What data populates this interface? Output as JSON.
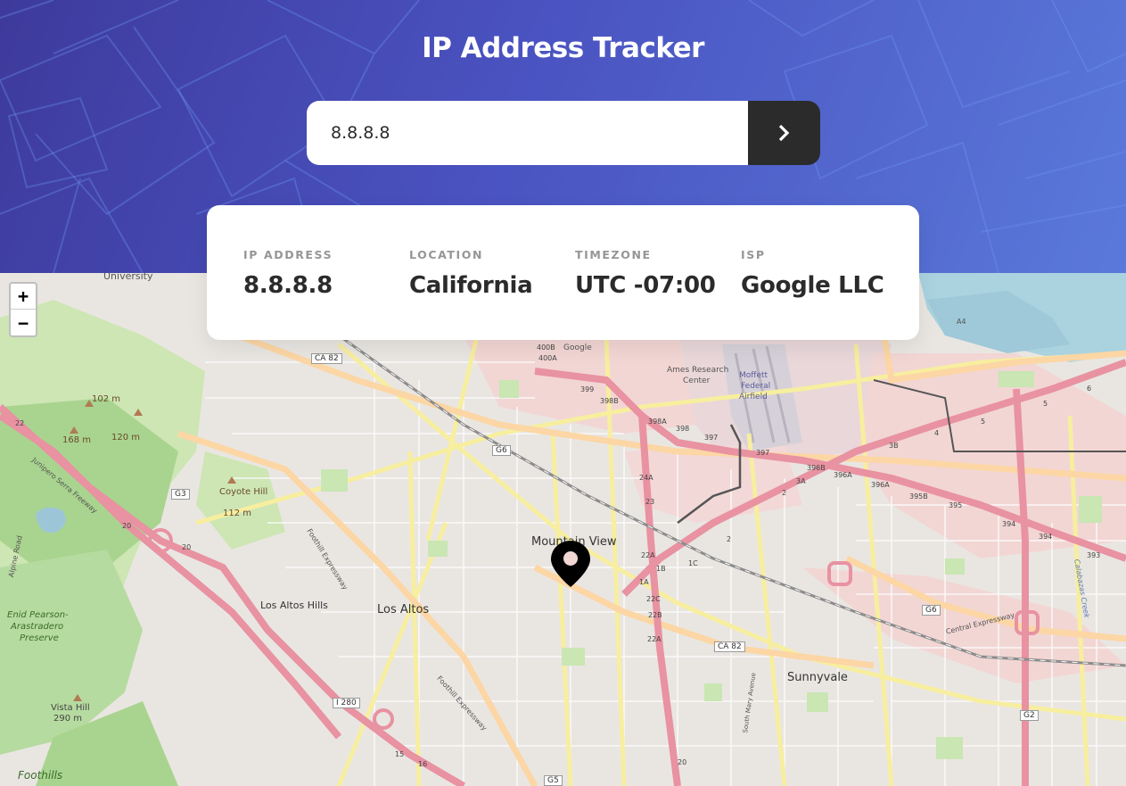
{
  "header": {
    "title": "IP Address Tracker"
  },
  "search": {
    "value": "8.8.8.8",
    "button_icon": "chevron-right-icon"
  },
  "info": {
    "ip": {
      "label": "IP ADDRESS",
      "value": "8.8.8.8"
    },
    "location": {
      "label": "LOCATION",
      "value": "California"
    },
    "timezone": {
      "label": "TIMEZONE",
      "value": "UTC -07:00"
    },
    "isp": {
      "label": "ISP",
      "value": "Google LLC"
    }
  },
  "map": {
    "zoom_in": "+",
    "zoom_out": "−",
    "marker_icon": "location-pin-icon",
    "labels": {
      "mountain_view": "Mountain View",
      "los_altos": "Los Altos",
      "los_altos_hills": "Los Altos Hills",
      "sunnyvale": "Sunnyvale",
      "coyote_hill": "Coyote Hill",
      "coyote_hill_elev": "112 m",
      "ames": "Ames Research",
      "ames2": "Center",
      "moffett": "Moffett",
      "moffett2": "Federal",
      "moffett3": "Airfield",
      "vista_hill": "Vista Hill",
      "vista_hill_elev": "290 m",
      "enid": "Enid Pearson-",
      "enid2": "Arastradero",
      "enid3": "Preserve",
      "foothills": "Foothills",
      "university": "University",
      "google": "Google",
      "elev_102": "102 m",
      "elev_168": "168 m",
      "elev_120": "120 m",
      "ca82_top": "CA 82",
      "ca82_bottom": "CA 82",
      "g6_left": "G6",
      "g6_right": "G6",
      "g3": "G3",
      "g2": "G2",
      "g5": "G5",
      "i280": "I 280",
      "foothill_expy": "Foothill Expressway",
      "foothill_expy2": "Foothill Expressway",
      "central_expy": "Central Expressway",
      "junipero": "Junipero Serra Freeway",
      "south_mary": "South Mary Avenue",
      "alpine": "Alpine Road",
      "calabazas": "Calabazas Creek",
      "a4": "A4",
      "exit_400b": "400B",
      "exit_400a": "400A",
      "exit_399": "399",
      "exit_398b": "398B",
      "exit_398a": "398A",
      "exit_398": "398",
      "exit_397a": "397",
      "exit_397b": "397",
      "exit_396b": "396B",
      "exit_396a": "396A",
      "exit_396a2": "396A",
      "exit_395b": "395B",
      "exit_395": "395",
      "exit_394": "394",
      "exit_394b": "394",
      "exit_393": "393",
      "exit_3a": "3A",
      "exit_3b": "3B",
      "exit_2": "2",
      "exit_2b": "2",
      "exit_4": "4",
      "exit_5": "5",
      "exit_5b": "5",
      "exit_6": "6",
      "exit_1c": "1C",
      "exit_1b": "1B",
      "exit_1a": "1A",
      "exit_22a": "22A",
      "exit_22c": "22C",
      "exit_22b": "22B",
      "exit_22a2": "22A",
      "exit_23": "23",
      "exit_24a": "24A",
      "exit_20": "20",
      "exit_20b": "20",
      "exit_20c": "20",
      "exit_22": "22",
      "exit_15": "15",
      "exit_16": "16"
    }
  },
  "colors": {
    "header_start": "#3e3a9c",
    "header_end": "#5a79da",
    "button": "#2b2b2b",
    "marker": "#000000"
  }
}
